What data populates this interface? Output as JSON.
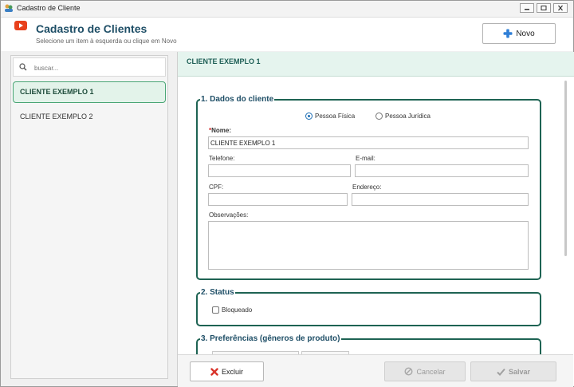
{
  "window": {
    "title": "Cadastro de Cliente"
  },
  "header": {
    "title": "Cadastro de Clientes",
    "subtitle": "Selecione um item à esquerda ou clique em Novo",
    "new_button": "Novo"
  },
  "sidebar": {
    "search_placeholder": "buscar...",
    "items": [
      {
        "label": "CLIENTE EXEMPLO 1",
        "selected": true
      },
      {
        "label": "CLIENTE EXEMPLO 2",
        "selected": false
      }
    ]
  },
  "detail": {
    "client_header": "CLIENTE EXEMPLO 1",
    "section1": {
      "legend": "1. Dados do cliente",
      "radio_pf": "Pessoa Física",
      "radio_pj": "Pessoa Jurídica",
      "selected_type": "Pessoa Física",
      "required_mark": "*",
      "name_label": "Nome:",
      "name_value": "CLIENTE EXEMPLO 1",
      "phone_label": "Telefone:",
      "email_label": "E-mail:",
      "cpf_label": "CPF:",
      "address_label": "Endereço:",
      "notes_label": "Observações:"
    },
    "section2": {
      "legend": "2. Status",
      "blocked_label": "Bloqueado",
      "blocked": false
    },
    "section3": {
      "legend": "3. Preferências (gêneros de produto)"
    }
  },
  "footer": {
    "delete_label": "Excluir",
    "cancel_label": "Cancelar",
    "save_label": "Salvar"
  },
  "colors": {
    "accent": "#1e6353",
    "title": "#1e4e66",
    "selected_bg": "#e3f3ea",
    "add_icon": "#2f7fd6",
    "delete_icon": "#d9342b"
  }
}
